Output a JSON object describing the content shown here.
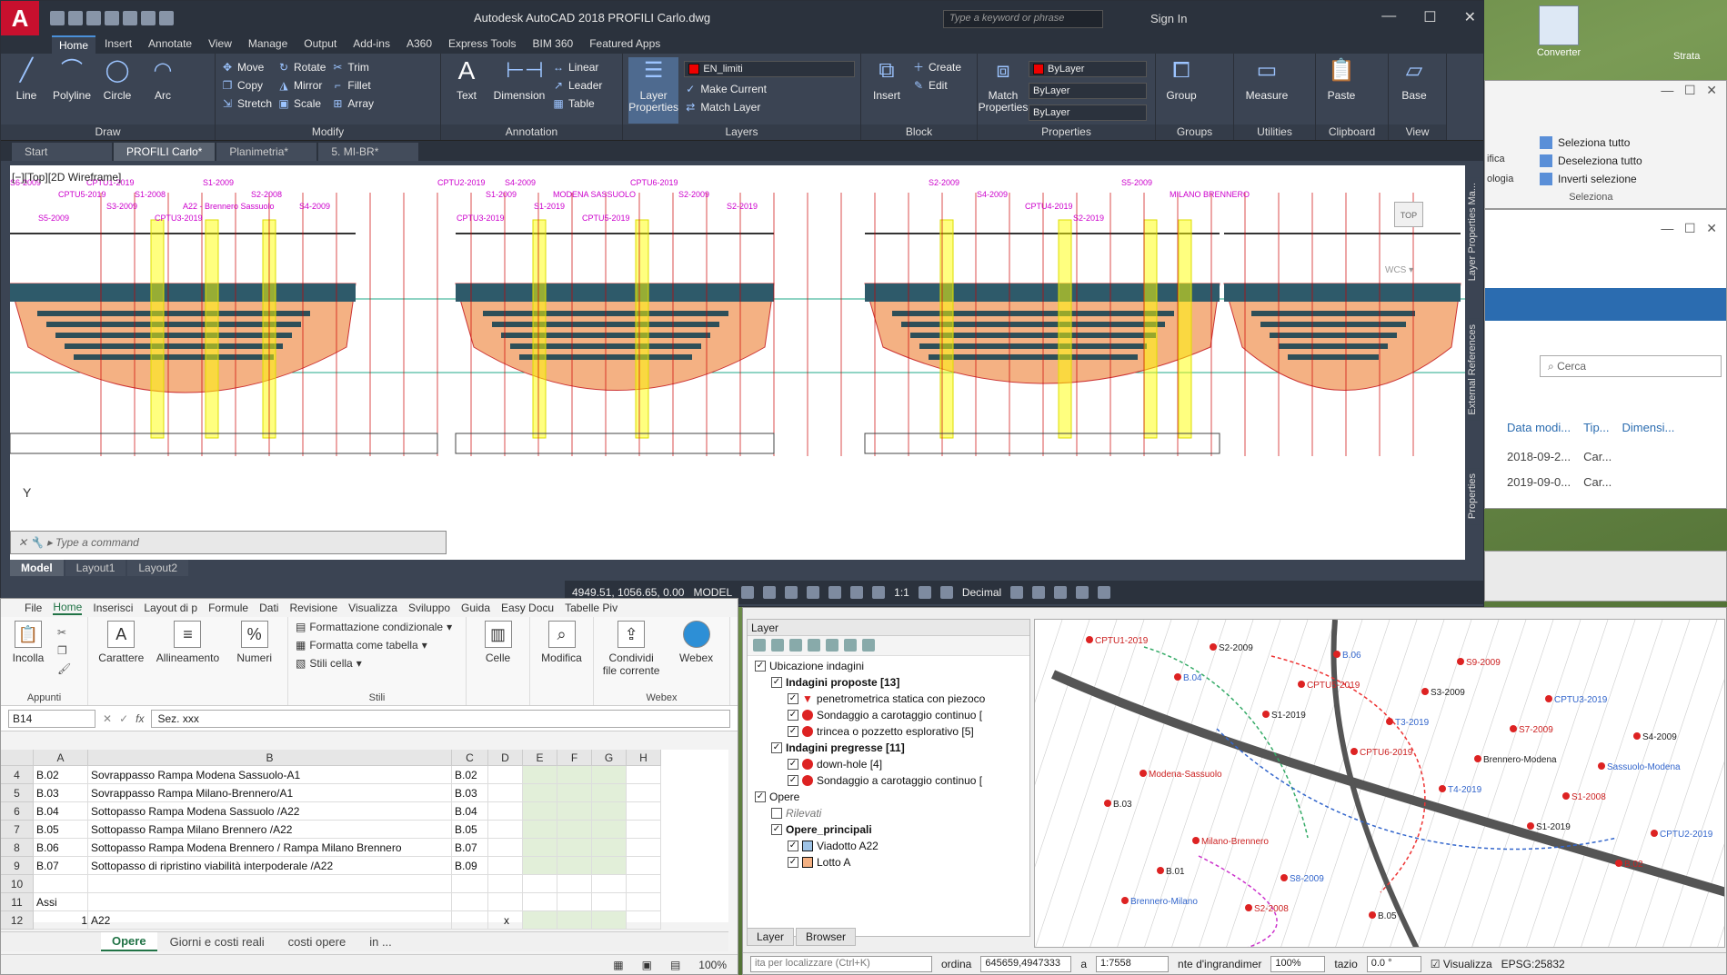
{
  "acad": {
    "title": "Autodesk AutoCAD 2018    PROFILI Carlo.dwg",
    "search_placeholder": "Type a keyword or phrase",
    "signin": "Sign In",
    "ribbon_tabs": [
      "Home",
      "Insert",
      "Annotate",
      "View",
      "Manage",
      "Output",
      "Add-ins",
      "A360",
      "Express Tools",
      "BIM 360",
      "Featured Apps"
    ],
    "draw": {
      "label": "Draw",
      "line": "Line",
      "polyline": "Polyline",
      "circle": "Circle",
      "arc": "Arc"
    },
    "modify": {
      "label": "Modify",
      "move": "Move",
      "rotate": "Rotate",
      "trim": "Trim",
      "copy": "Copy",
      "mirror": "Mirror",
      "fillet": "Fillet",
      "stretch": "Stretch",
      "scale": "Scale",
      "array": "Array"
    },
    "annotation": {
      "label": "Annotation",
      "text": "Text",
      "dimension": "Dimension",
      "linear": "Linear",
      "leader": "Leader",
      "table": "Table"
    },
    "layers": {
      "label": "Layers",
      "layer_properties": "Layer Properties",
      "current_layer": "EN_limiti",
      "make_current": "Make Current",
      "match_layer": "Match Layer"
    },
    "block": {
      "label": "Block",
      "insert": "Insert",
      "create": "Create",
      "edit": "Edit"
    },
    "properties": {
      "label": "Properties",
      "match": "Match Properties",
      "bylayer": "ByLayer",
      "bylayer2": "ByLayer",
      "bylayer3": "ByLayer"
    },
    "groups": {
      "label": "Groups",
      "group": "Group"
    },
    "utilities": {
      "label": "Utilities",
      "measure": "Measure"
    },
    "clipboard": {
      "label": "Clipboard",
      "paste": "Paste"
    },
    "view": {
      "label": "View",
      "base": "Base"
    },
    "doc_tabs": [
      "Start",
      "PROFILI Carlo*",
      "Planimetria*",
      "5. MI-BR*"
    ],
    "view_label": "[−][Top][2D Wireframe]",
    "cmd_placeholder": "Type a command",
    "layout_tabs": [
      "Model",
      "Layout1",
      "Layout2"
    ],
    "coords": "4949.51, 1056.65, 0.00",
    "model": "MODEL",
    "scale": "1:1",
    "units": "Decimal",
    "side_panels": [
      "Layer Properties Ma...",
      "External References",
      "Properties"
    ],
    "viewcube_top": "TOP",
    "wcs": "WCS",
    "ucs_y": "Y",
    "labels_section1": [
      "S6-2009",
      "CPTU5-2019",
      "S3-2009",
      "CPTU3-2019",
      "S1-2009",
      "S2-2008",
      "S4-2009",
      "S5-2009",
      "CPTU1-2019",
      "S1-2008",
      "A22 - Brennero Sassuolo"
    ],
    "labels_section2": [
      "CPTU2-2019",
      "S1-2009",
      "S1-2019",
      "CPTU5-2019",
      "CPTU6-2019",
      "S2-2009",
      "S2-2019",
      "CPTU3-2019",
      "S4-2009",
      "MODENA SASSUOLO"
    ],
    "labels_section3": [
      "S2-2009",
      "S4-2009",
      "CPTU4-2019",
      "S2-2019",
      "S5-2009",
      "MILANO BRENNERO"
    ]
  },
  "excel": {
    "tabs": [
      "File",
      "Home",
      "Inserisci",
      "Layout di p",
      "Formule",
      "Dati",
      "Revisione",
      "Visualizza",
      "Sviluppo",
      "Guida",
      "Easy Docu",
      "Tabelle Piv"
    ],
    "clipboard": "Appunti",
    "paste": "Incolla",
    "font": "Carattere",
    "alignment": "Allineamento",
    "numbers": "Numeri",
    "cond_format": "Formattazione condizionale",
    "format_table": "Formatta come tabella",
    "cell_styles": "Stili cella",
    "styles": "Stili",
    "cells": "Celle",
    "edit": "Modifica",
    "share": "Condividi file corrente",
    "webex": "Webex",
    "namebox": "B14",
    "formula": "Sez. xxx",
    "cols": [
      "A",
      "B",
      "C",
      "D",
      "E",
      "F",
      "G",
      "H"
    ],
    "rows": [
      {
        "n": "4",
        "a": "B.02",
        "b": "Sovrappasso Rampa Modena Sassuolo-A1",
        "c": "B.02"
      },
      {
        "n": "5",
        "a": "B.03",
        "b": "Sovrappasso Rampa Milano-Brennero/A1",
        "c": "B.03"
      },
      {
        "n": "6",
        "a": "B.04",
        "b": "Sottopasso Rampa Modena Sassuolo /A22",
        "c": "B.04"
      },
      {
        "n": "7",
        "a": "B.05",
        "b": "Sottopasso Rampa Milano Brennero /A22",
        "c": "B.05"
      },
      {
        "n": "8",
        "a": "B.06",
        "b": "Sottopasso Rampa Modena Brennero / Rampa Milano Brennero",
        "c": "B.07"
      },
      {
        "n": "9",
        "a": "B.07",
        "b": "Sottopasso di ripristino viabilità interpoderale /A22",
        "c": "B.09"
      },
      {
        "n": "10",
        "a": "",
        "b": "",
        "c": ""
      },
      {
        "n": "11",
        "a": "Assi",
        "b": "",
        "c": ""
      },
      {
        "n": "12",
        "a": "1",
        "b": "A22",
        "c": "",
        "d": "x"
      }
    ],
    "sheet_tabs": [
      "Opere",
      "Giorni e costi reali",
      "costi opere",
      "in ..."
    ],
    "zoom": "100%"
  },
  "qgis": {
    "panel_title": "Layer",
    "tree": [
      {
        "level": 0,
        "label": "Ubicazione indagini",
        "bold": false,
        "check": true
      },
      {
        "level": 1,
        "label": "Indagini proposte [13]",
        "bold": true,
        "check": true
      },
      {
        "level": 2,
        "label": "penetrometrica statica con piezoco",
        "bold": false,
        "check": true,
        "icon": "tri"
      },
      {
        "level": 2,
        "label": "Sondaggio a carotaggio continuo [",
        "bold": false,
        "check": true,
        "icon": "dot"
      },
      {
        "level": 2,
        "label": "trincea o pozzetto esplorativo [5]",
        "bold": false,
        "check": true,
        "icon": "dot"
      },
      {
        "level": 1,
        "label": "Indagini pregresse [11]",
        "bold": true,
        "check": true
      },
      {
        "level": 2,
        "label": "down-hole [4]",
        "bold": false,
        "check": true,
        "icon": "dot"
      },
      {
        "level": 2,
        "label": "Sondaggio a carotaggio continuo [",
        "bold": false,
        "check": true,
        "icon": "dot"
      },
      {
        "level": 0,
        "label": "Opere",
        "bold": false,
        "check": true
      },
      {
        "level": 1,
        "label": "Rilevati",
        "bold": false,
        "check": false,
        "italic": true
      },
      {
        "level": 1,
        "label": "Opere_principali",
        "bold": true,
        "check": true
      },
      {
        "level": 2,
        "label": "Viadotto A22",
        "bold": false,
        "check": true,
        "icon": "blue"
      },
      {
        "level": 2,
        "label": "Lotto A",
        "bold": false,
        "check": true,
        "icon": "orange"
      }
    ],
    "bottom_tabs": [
      "Layer",
      "Browser"
    ],
    "locator": "ita per localizzare (Ctrl+K)",
    "coord_label": "ordina",
    "coords": "645659,4947333",
    "scale_label": "a",
    "scale": "1:7558",
    "magnifier_label": "nte d'ingrandimer",
    "magnifier": "100%",
    "rotation_label": "tazio",
    "rotation": "0.0 °",
    "render": "Visualizza",
    "crs": "EPSG:25832",
    "map_labels": [
      "CPTU1-2019",
      "B.04",
      "S1-2019",
      "CPTU6-2019",
      "T4-2019",
      "S1-2019",
      "B.02",
      "Brennero-Milano",
      "S2-2009",
      "CPTU5-2019",
      "T3-2019",
      "Brennero-Modena",
      "S1-2008",
      "CPTU2-2019",
      "B.01",
      "S2-2008",
      "B.06",
      "S3-2009",
      "S7-2009",
      "Sassuolo-Modena",
      "B.03",
      "Milano-Brennero",
      "S8-2009",
      "B.05",
      "S9-2009",
      "CPTU3-2019",
      "S4-2009",
      "Modena-Sassuolo"
    ]
  },
  "right": {
    "desk_icon": "Converter",
    "select_all": "Seleziona tutto",
    "deselect_all": "Deseleziona tutto",
    "invert": "Inverti selezione",
    "selection": "Seleziona",
    "search": "Cerca",
    "col_date": "Data modi...",
    "col_type": "Tip...",
    "col_size": "Dimensi...",
    "row1_date": "2018-09-2...",
    "row1_type": "Car...",
    "row2_date": "2019-09-0...",
    "row2_type": "Car...",
    "partial1": "ifica",
    "partial2": "ologia",
    "strata": "Strata"
  }
}
